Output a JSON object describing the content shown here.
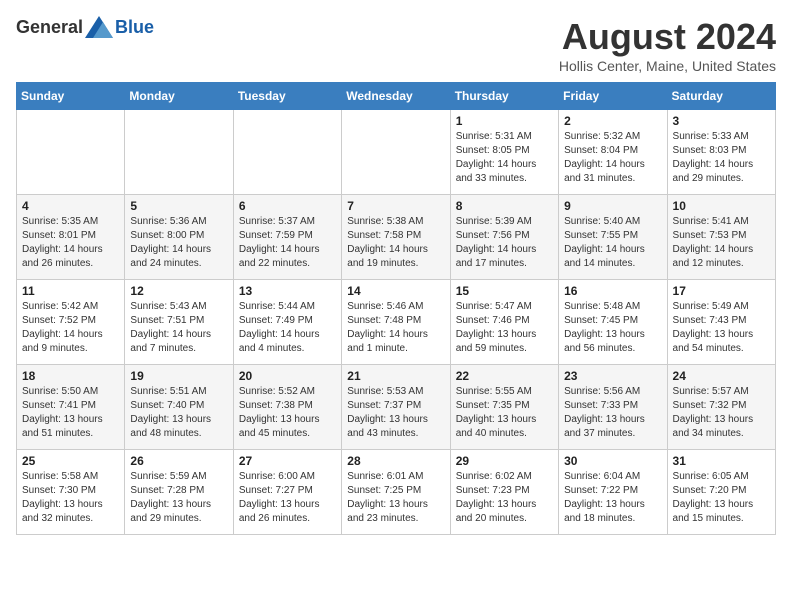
{
  "header": {
    "logo_general": "General",
    "logo_blue": "Blue",
    "title": "August 2024",
    "subtitle": "Hollis Center, Maine, United States"
  },
  "weekdays": [
    "Sunday",
    "Monday",
    "Tuesday",
    "Wednesday",
    "Thursday",
    "Friday",
    "Saturday"
  ],
  "weeks": [
    [
      {
        "day": "",
        "info": ""
      },
      {
        "day": "",
        "info": ""
      },
      {
        "day": "",
        "info": ""
      },
      {
        "day": "",
        "info": ""
      },
      {
        "day": "1",
        "info": "Sunrise: 5:31 AM\nSunset: 8:05 PM\nDaylight: 14 hours\nand 33 minutes."
      },
      {
        "day": "2",
        "info": "Sunrise: 5:32 AM\nSunset: 8:04 PM\nDaylight: 14 hours\nand 31 minutes."
      },
      {
        "day": "3",
        "info": "Sunrise: 5:33 AM\nSunset: 8:03 PM\nDaylight: 14 hours\nand 29 minutes."
      }
    ],
    [
      {
        "day": "4",
        "info": "Sunrise: 5:35 AM\nSunset: 8:01 PM\nDaylight: 14 hours\nand 26 minutes."
      },
      {
        "day": "5",
        "info": "Sunrise: 5:36 AM\nSunset: 8:00 PM\nDaylight: 14 hours\nand 24 minutes."
      },
      {
        "day": "6",
        "info": "Sunrise: 5:37 AM\nSunset: 7:59 PM\nDaylight: 14 hours\nand 22 minutes."
      },
      {
        "day": "7",
        "info": "Sunrise: 5:38 AM\nSunset: 7:58 PM\nDaylight: 14 hours\nand 19 minutes."
      },
      {
        "day": "8",
        "info": "Sunrise: 5:39 AM\nSunset: 7:56 PM\nDaylight: 14 hours\nand 17 minutes."
      },
      {
        "day": "9",
        "info": "Sunrise: 5:40 AM\nSunset: 7:55 PM\nDaylight: 14 hours\nand 14 minutes."
      },
      {
        "day": "10",
        "info": "Sunrise: 5:41 AM\nSunset: 7:53 PM\nDaylight: 14 hours\nand 12 minutes."
      }
    ],
    [
      {
        "day": "11",
        "info": "Sunrise: 5:42 AM\nSunset: 7:52 PM\nDaylight: 14 hours\nand 9 minutes."
      },
      {
        "day": "12",
        "info": "Sunrise: 5:43 AM\nSunset: 7:51 PM\nDaylight: 14 hours\nand 7 minutes."
      },
      {
        "day": "13",
        "info": "Sunrise: 5:44 AM\nSunset: 7:49 PM\nDaylight: 14 hours\nand 4 minutes."
      },
      {
        "day": "14",
        "info": "Sunrise: 5:46 AM\nSunset: 7:48 PM\nDaylight: 14 hours\nand 1 minute."
      },
      {
        "day": "15",
        "info": "Sunrise: 5:47 AM\nSunset: 7:46 PM\nDaylight: 13 hours\nand 59 minutes."
      },
      {
        "day": "16",
        "info": "Sunrise: 5:48 AM\nSunset: 7:45 PM\nDaylight: 13 hours\nand 56 minutes."
      },
      {
        "day": "17",
        "info": "Sunrise: 5:49 AM\nSunset: 7:43 PM\nDaylight: 13 hours\nand 54 minutes."
      }
    ],
    [
      {
        "day": "18",
        "info": "Sunrise: 5:50 AM\nSunset: 7:41 PM\nDaylight: 13 hours\nand 51 minutes."
      },
      {
        "day": "19",
        "info": "Sunrise: 5:51 AM\nSunset: 7:40 PM\nDaylight: 13 hours\nand 48 minutes."
      },
      {
        "day": "20",
        "info": "Sunrise: 5:52 AM\nSunset: 7:38 PM\nDaylight: 13 hours\nand 45 minutes."
      },
      {
        "day": "21",
        "info": "Sunrise: 5:53 AM\nSunset: 7:37 PM\nDaylight: 13 hours\nand 43 minutes."
      },
      {
        "day": "22",
        "info": "Sunrise: 5:55 AM\nSunset: 7:35 PM\nDaylight: 13 hours\nand 40 minutes."
      },
      {
        "day": "23",
        "info": "Sunrise: 5:56 AM\nSunset: 7:33 PM\nDaylight: 13 hours\nand 37 minutes."
      },
      {
        "day": "24",
        "info": "Sunrise: 5:57 AM\nSunset: 7:32 PM\nDaylight: 13 hours\nand 34 minutes."
      }
    ],
    [
      {
        "day": "25",
        "info": "Sunrise: 5:58 AM\nSunset: 7:30 PM\nDaylight: 13 hours\nand 32 minutes."
      },
      {
        "day": "26",
        "info": "Sunrise: 5:59 AM\nSunset: 7:28 PM\nDaylight: 13 hours\nand 29 minutes."
      },
      {
        "day": "27",
        "info": "Sunrise: 6:00 AM\nSunset: 7:27 PM\nDaylight: 13 hours\nand 26 minutes."
      },
      {
        "day": "28",
        "info": "Sunrise: 6:01 AM\nSunset: 7:25 PM\nDaylight: 13 hours\nand 23 minutes."
      },
      {
        "day": "29",
        "info": "Sunrise: 6:02 AM\nSunset: 7:23 PM\nDaylight: 13 hours\nand 20 minutes."
      },
      {
        "day": "30",
        "info": "Sunrise: 6:04 AM\nSunset: 7:22 PM\nDaylight: 13 hours\nand 18 minutes."
      },
      {
        "day": "31",
        "info": "Sunrise: 6:05 AM\nSunset: 7:20 PM\nDaylight: 13 hours\nand 15 minutes."
      }
    ]
  ]
}
